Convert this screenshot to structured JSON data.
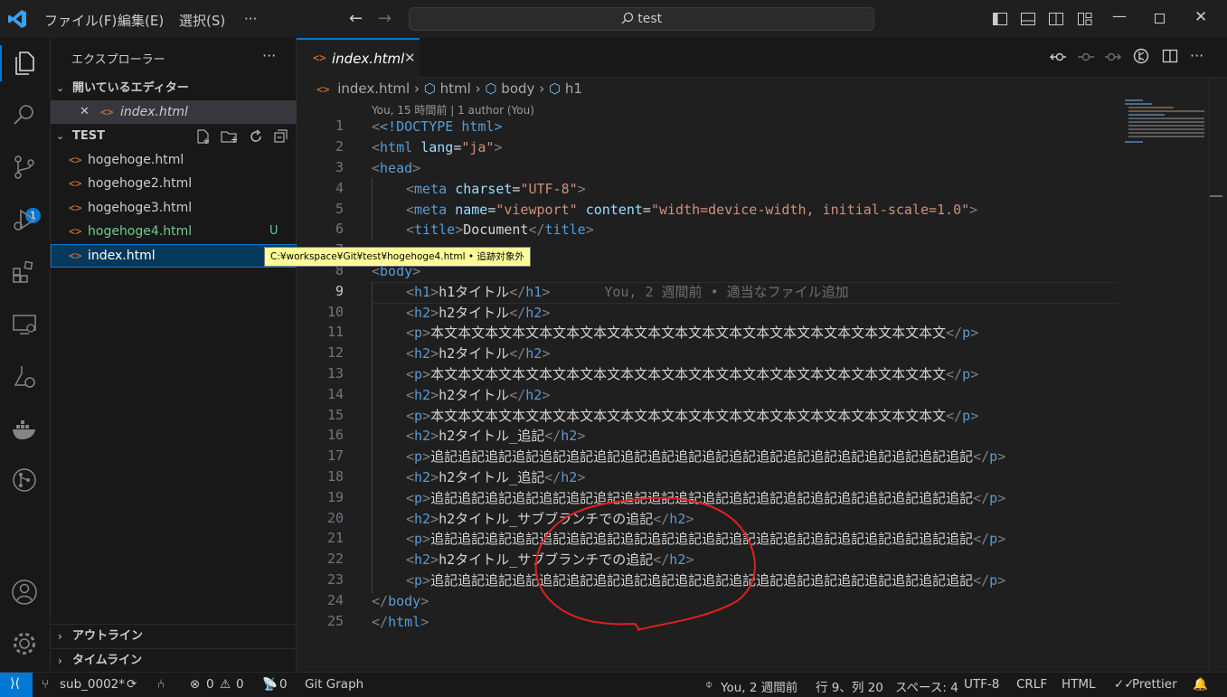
{
  "titlebar": {
    "menu": [
      "ファイル(F)",
      "編集(E)",
      "選択(S)",
      "···"
    ],
    "search": "test"
  },
  "activity": {
    "source_control_badge": "1"
  },
  "sidebar": {
    "title": "エクスプローラー",
    "more": "···",
    "open_editors_title": "開いているエディター",
    "open_editors": [
      {
        "name": "index.html"
      }
    ],
    "folder_title": "TEST",
    "files": [
      {
        "name": "hogehoge.html",
        "status": ""
      },
      {
        "name": "hogehoge2.html",
        "status": ""
      },
      {
        "name": "hogehoge3.html",
        "status": ""
      },
      {
        "name": "hogehoge4.html",
        "status": "U"
      },
      {
        "name": "index.html",
        "status": ""
      }
    ],
    "tooltip": "C:¥workspace¥Git¥test¥hogehoge4.html • 追跡対象外",
    "outline_title": "アウトライン",
    "timeline_title": "タイムライン"
  },
  "editor": {
    "tab": "index.html",
    "breadcrumb": [
      "index.html",
      "html",
      "body",
      "h1"
    ],
    "codelens": "You, 15 時間前 | 1 author (You)",
    "blame": "You, 2 週間前 • 適当なファイル追加",
    "lines": [
      "1",
      "2",
      "3",
      "4",
      "5",
      "6",
      "7",
      "8",
      "9",
      "10",
      "11",
      "12",
      "13",
      "14",
      "15",
      "16",
      "17",
      "18",
      "19",
      "20",
      "21",
      "22",
      "23",
      "24",
      "25"
    ],
    "code": {
      "l1": "<!DOCTYPE html>",
      "l2_tag": "html",
      "l2_attr": "lang",
      "l2_val": "\"ja\"",
      "l3": "head",
      "l4_attr": "charset",
      "l4_val": "\"UTF-8\"",
      "l5_attr1": "name",
      "l5_val1": "\"viewport\"",
      "l5_attr2": "content",
      "l5_val2": "\"width=device-width, initial-scale=1.0\"",
      "l6_text": "Document",
      "l8": "body",
      "h1_text": "h1タイトル",
      "h2_text": "h2タイトル",
      "h2_add_text": "h2タイトル_追記",
      "h2_sub_text": "h2タイトル_サブブランチでの追記",
      "p_text": "本文本文本文本文本文本文本文本文本文本文本文本文本文本文本文本文本文本文本文",
      "p_add_text": "追記追記追記追記追記追記追記追記追記追記追記追記追記追記追記追記追記追記追記追記"
    }
  },
  "statusbar": {
    "branch": "sub_0002*",
    "errors": "0",
    "warnings": "0",
    "ports": "0",
    "git_graph": "Git Graph",
    "blame": "You, 2 週間前",
    "position": "行 9、列 20",
    "spaces": "スペース: 4",
    "encoding": "UTF-8",
    "eol": "CRLF",
    "language": "HTML",
    "formatter": "Prettier"
  },
  "colors": {
    "accent": "#0078d4",
    "remote": "#0078d4",
    "untracked": "#73c991",
    "annotation": "#e02020"
  }
}
